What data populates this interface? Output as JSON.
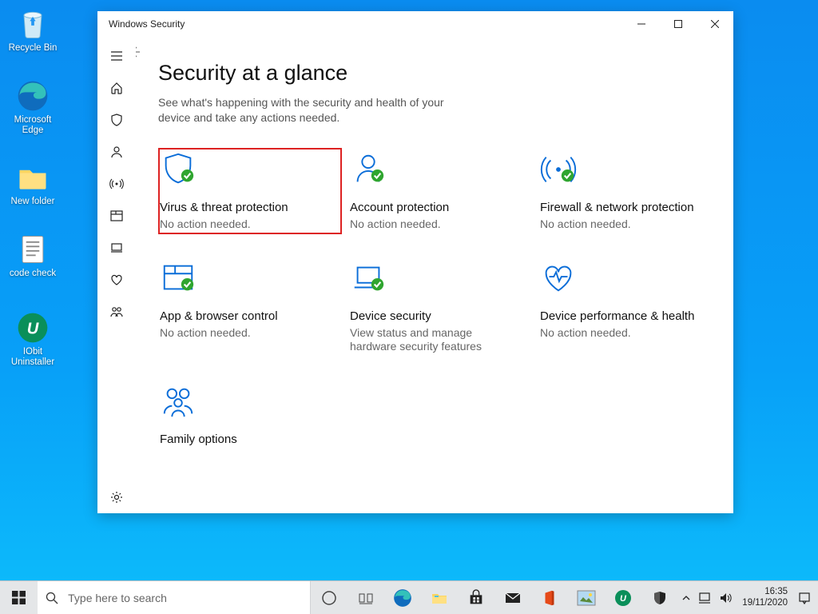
{
  "window": {
    "title": "Windows Security",
    "page_title": "Security at a glance",
    "page_subtitle": "See what's happening with the security and health of your device and take any actions needed."
  },
  "tiles": [
    {
      "key": "virus",
      "label": "Virus & threat protection",
      "status": "No action needed.",
      "highlighted": true
    },
    {
      "key": "account",
      "label": "Account protection",
      "status": "No action needed."
    },
    {
      "key": "firewall",
      "label": "Firewall & network protection",
      "status": "No action needed."
    },
    {
      "key": "browser",
      "label": "App & browser control",
      "status": "No action needed."
    },
    {
      "key": "device",
      "label": "Device security",
      "status": "View status and manage hardware security features"
    },
    {
      "key": "perf",
      "label": "Device performance & health",
      "status": "No action needed."
    },
    {
      "key": "family",
      "label": "Family options",
      "status": ""
    }
  ],
  "desktop_icons": [
    {
      "key": "recycle",
      "label": "Recycle Bin"
    },
    {
      "key": "edge",
      "label": "Microsoft Edge"
    },
    {
      "key": "newfolder",
      "label": "New folder"
    },
    {
      "key": "codecheck",
      "label": "code check"
    },
    {
      "key": "iobit",
      "label": "IObit Uninstaller"
    }
  ],
  "taskbar": {
    "search_placeholder": "Type here to search",
    "clock_time": "16:35",
    "clock_date": "19/11/2020"
  }
}
